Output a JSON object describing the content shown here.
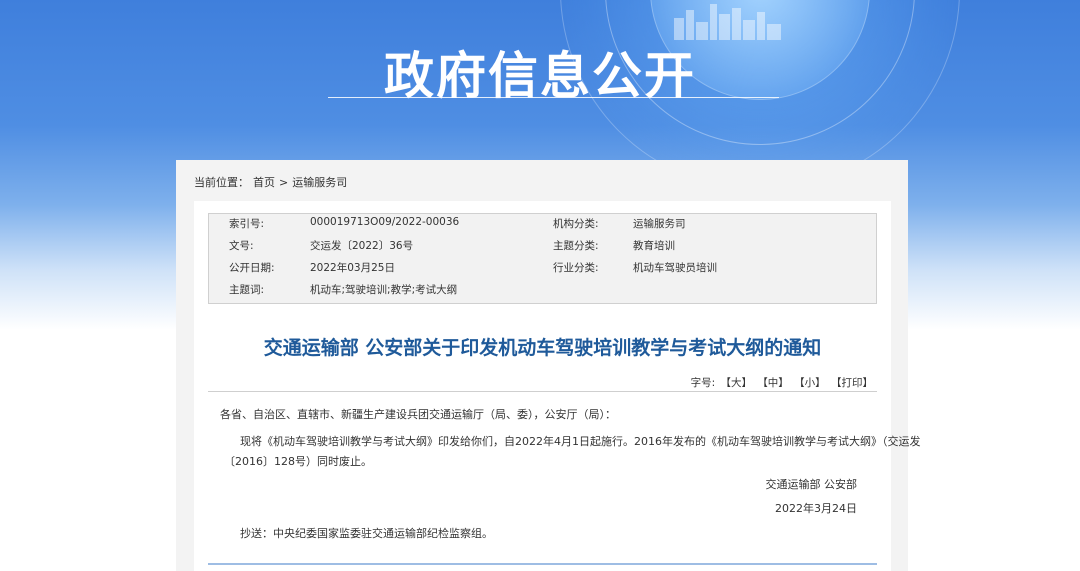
{
  "banner": {
    "title": "政府信息公开"
  },
  "breadcrumb": {
    "label": "当前位置：",
    "home": "首页",
    "sep": ">",
    "current": "运输服务司"
  },
  "meta": {
    "index_label": "索引号:",
    "index_value": "000019713O09/2022-00036",
    "org_label": "机构分类:",
    "org_value": "运输服务司",
    "doc_label": "文号:",
    "doc_value": "交运发〔2022〕36号",
    "topic_label": "主题分类:",
    "topic_value": "教育培训",
    "date_label": "公开日期:",
    "date_value": "2022年03月25日",
    "industry_label": "行业分类:",
    "industry_value": "机动车驾驶员培训",
    "keywords_label": "主题词:",
    "keywords_value": "机动车;驾驶培训;教学;考试大纲"
  },
  "article": {
    "title": "交通运输部 公安部关于印发机动车驾驶培训教学与考试大纲的通知",
    "fontsize_label": "字号:",
    "size_large": "【大】",
    "size_medium": "【中】",
    "size_small": "【小】",
    "print": "【打印】",
    "salutation": "各省、自治区、直辖市、新疆生产建设兵团交通运输厅（局、委），公安厅（局）：",
    "para1_line1": "现将《机动车驾驶培训教学与考试大纲》印发给你们，自2022年4月1日起施行。2016年发布的《机动车驾驶培训教学与考试大纲》（交运发",
    "para1_line2": "〔2016〕128号）同时废止。",
    "signature": "交通运输部 公安部",
    "sign_date": "2022年3月24日",
    "cc": "抄送：中央纪委国家监委驻交通运输部纪检监察组。"
  }
}
